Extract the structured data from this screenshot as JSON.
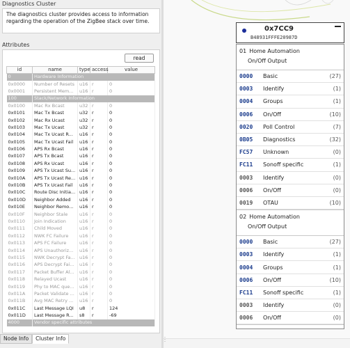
{
  "left": {
    "diagnostics_title": "Diagnostics Cluster",
    "description": "The diagnostics cluster provides access to information regarding the operation of the ZigBee stack over time.",
    "attributes_title": "Attributes",
    "read_label": "read",
    "columns": [
      "id",
      "name",
      "type",
      "access",
      "value"
    ],
    "rows": [
      {
        "group": true,
        "id": "0",
        "name": "Hardware Information",
        "type": "",
        "access": "",
        "value": ""
      },
      {
        "dim": true,
        "id": "0x0000",
        "name": "Number of Resets",
        "type": "u16",
        "access": "r",
        "value": "0"
      },
      {
        "dim": true,
        "id": "0x0001",
        "name": "Persistent Mem...",
        "type": "u16",
        "access": "r",
        "value": "0"
      },
      {
        "group": true,
        "id": "100",
        "name": "Stack/Network Information",
        "type": "",
        "access": "",
        "value": ""
      },
      {
        "dim": true,
        "id": "0x0100",
        "name": "Mac Rx Bcast",
        "type": "u32",
        "access": "r",
        "value": "0"
      },
      {
        "id": "0x0101",
        "name": "Mac Tx Bcast",
        "type": "u32",
        "access": "r",
        "value": "0"
      },
      {
        "id": "0x0102",
        "name": "Mac Rx Ucast",
        "type": "u32",
        "access": "r",
        "value": "0"
      },
      {
        "id": "0x0103",
        "name": "Mac Tx Ucast",
        "type": "u32",
        "access": "r",
        "value": "0"
      },
      {
        "id": "0x0104",
        "name": "Mac Tx Ucast R...",
        "type": "u16",
        "access": "r",
        "value": "0"
      },
      {
        "id": "0x0105",
        "name": "Mac Tx Ucast Fail",
        "type": "u16",
        "access": "r",
        "value": "0"
      },
      {
        "id": "0x0106",
        "name": "APS Rx Bcast",
        "type": "u16",
        "access": "r",
        "value": "0"
      },
      {
        "id": "0x0107",
        "name": "APS Tx Bcast",
        "type": "u16",
        "access": "r",
        "value": "0"
      },
      {
        "id": "0x0108",
        "name": "APS Rx Ucast",
        "type": "u16",
        "access": "r",
        "value": "0"
      },
      {
        "id": "0x0109",
        "name": "APS Tx Ucast Su...",
        "type": "u16",
        "access": "r",
        "value": "0"
      },
      {
        "id": "0x010A",
        "name": "APS Tx Ucast Re...",
        "type": "u16",
        "access": "r",
        "value": "0"
      },
      {
        "id": "0x010B",
        "name": "APS Tx Ucast Fail",
        "type": "u16",
        "access": "r",
        "value": "0"
      },
      {
        "id": "0x010C",
        "name": "Route Disc Initia...",
        "type": "u16",
        "access": "r",
        "value": "0"
      },
      {
        "id": "0x010D",
        "name": "Neighbor Added",
        "type": "u16",
        "access": "r",
        "value": "0"
      },
      {
        "id": "0x010E",
        "name": "Neighbor Remo...",
        "type": "u16",
        "access": "r",
        "value": "0"
      },
      {
        "dim": true,
        "id": "0x010F",
        "name": "Neighbor Stale",
        "type": "u16",
        "access": "r",
        "value": "0"
      },
      {
        "dim": true,
        "id": "0x0110",
        "name": "Join Indication",
        "type": "u16",
        "access": "r",
        "value": "0"
      },
      {
        "dim": true,
        "id": "0x0111",
        "name": "Child Moved",
        "type": "u16",
        "access": "r",
        "value": "0"
      },
      {
        "dim": true,
        "id": "0x0112",
        "name": "NWK FC Failure",
        "type": "u16",
        "access": "r",
        "value": "0"
      },
      {
        "dim": true,
        "id": "0x0113",
        "name": "APS FC Failure",
        "type": "u16",
        "access": "r",
        "value": "0"
      },
      {
        "dim": true,
        "id": "0x0114",
        "name": "APS Unauthoriz...",
        "type": "u16",
        "access": "r",
        "value": "0"
      },
      {
        "dim": true,
        "id": "0x0115",
        "name": "NWK Decrypt Fa...",
        "type": "u16",
        "access": "r",
        "value": "0"
      },
      {
        "dim": true,
        "id": "0x0116",
        "name": "APS Decrypt Fai...",
        "type": "u16",
        "access": "r",
        "value": "0"
      },
      {
        "dim": true,
        "id": "0x0117",
        "name": "Packet Buffer Al...",
        "type": "u16",
        "access": "r",
        "value": "0"
      },
      {
        "dim": true,
        "id": "0x0118",
        "name": "Relayed Ucast",
        "type": "u16",
        "access": "r",
        "value": "0"
      },
      {
        "dim": true,
        "id": "0x0119",
        "name": "Phy to MAC que...",
        "type": "u16",
        "access": "r",
        "value": "0"
      },
      {
        "dim": true,
        "id": "0x011A",
        "name": "Packet Validate ...",
        "type": "u16",
        "access": "r",
        "value": "0"
      },
      {
        "dim": true,
        "id": "0x011B",
        "name": "Avg MAC Retry ...",
        "type": "u16",
        "access": "r",
        "value": "0"
      },
      {
        "id": "0x011C",
        "name": "Last Message LQI",
        "type": "u8",
        "access": "r",
        "value": "124"
      },
      {
        "id": "0x011D",
        "name": "Last Message R...",
        "type": "s8",
        "access": "r",
        "value": "-69"
      },
      {
        "group": true,
        "id": "4000",
        "name": "Vendor specific attributes",
        "type": "",
        "access": "",
        "value": ""
      }
    ],
    "tabs": [
      "Node Info",
      "Cluster Info"
    ],
    "active_tab": "Cluster Info"
  },
  "node": {
    "address": "0x7CC9",
    "ieee": "B48931FFFE20987D",
    "status_color": "#1c2e9a",
    "endpoints": [
      {
        "number": "01",
        "profile": "Home Automation",
        "device": "On/Off Output",
        "clusters": [
          {
            "id": "0000",
            "name": "Basic",
            "count": "(27)",
            "server": true
          },
          {
            "id": "0003",
            "name": "Identify",
            "count": "(1)",
            "server": true
          },
          {
            "id": "0004",
            "name": "Groups",
            "count": "(1)",
            "server": true
          },
          {
            "id": "0006",
            "name": "On/Off",
            "count": "(10)",
            "server": true
          },
          {
            "id": "0020",
            "name": "Poll Control",
            "count": "(7)",
            "server": true
          },
          {
            "id": "0B05",
            "name": "Diagnostics",
            "count": "(32)",
            "server": true
          },
          {
            "id": "FC57",
            "name": "Unknown",
            "count": "(0)",
            "server": true
          },
          {
            "id": "FC11",
            "name": "Sonoff specific",
            "count": "(1)",
            "server": true
          },
          {
            "id": "0003",
            "name": "Identify",
            "count": "(0)",
            "server": false
          },
          {
            "id": "0006",
            "name": "On/Off",
            "count": "(0)",
            "server": false
          },
          {
            "id": "0019",
            "name": "OTAU",
            "count": "(10)",
            "server": false
          }
        ]
      },
      {
        "number": "02",
        "profile": "Home Automation",
        "device": "On/Off Output",
        "clusters": [
          {
            "id": "0000",
            "name": "Basic",
            "count": "(27)",
            "server": true
          },
          {
            "id": "0003",
            "name": "Identify",
            "count": "(1)",
            "server": true
          },
          {
            "id": "0004",
            "name": "Groups",
            "count": "(1)",
            "server": true
          },
          {
            "id": "0006",
            "name": "On/Off",
            "count": "(10)",
            "server": true
          },
          {
            "id": "FC11",
            "name": "Sonoff specific",
            "count": "(1)",
            "server": true
          },
          {
            "id": "0003",
            "name": "Identify",
            "count": "(0)",
            "server": false
          },
          {
            "id": "0006",
            "name": "On/Off",
            "count": "(0)",
            "server": false
          }
        ]
      }
    ]
  }
}
